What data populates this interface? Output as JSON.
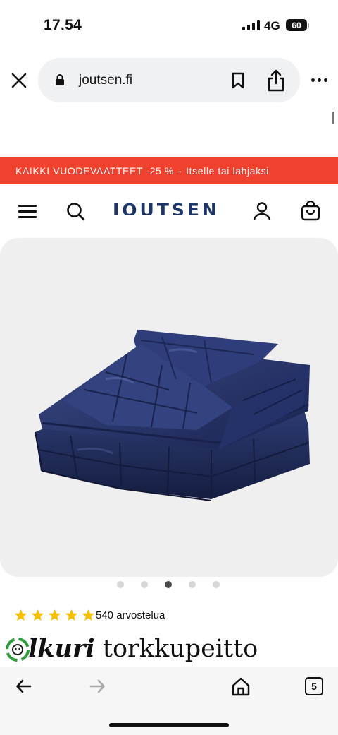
{
  "status_bar": {
    "time": "17.54",
    "network": "4G",
    "battery": "60"
  },
  "browser": {
    "url": "joutsen.fi",
    "tabs_count": "5"
  },
  "promo_banner": {
    "text": "KAIKKI VUODEVAATTEET -25 %",
    "separator": "-",
    "link": "Itselle tai lahjaksi"
  },
  "site_header": {
    "logo": "JOUTSEN",
    "brand_color": "#1d3466"
  },
  "carousel": {
    "slide_count": 5,
    "active_index": 2
  },
  "product": {
    "rating": 5,
    "reviews_label": "540 arvostelua",
    "title_partial_italic": "lkuri",
    "title_rest": "torkkupeitto"
  },
  "colors": {
    "banner": "#f0412f",
    "star": "#f6c000",
    "product_navy": "#1f2a55"
  },
  "icons": [
    "close-icon",
    "lock-icon",
    "bookmark-icon",
    "share-icon",
    "more-icon",
    "menu-icon",
    "search-icon",
    "account-icon",
    "cart-icon",
    "star-icon",
    "chat-icon",
    "back-icon",
    "forward-icon",
    "home-icon"
  ]
}
